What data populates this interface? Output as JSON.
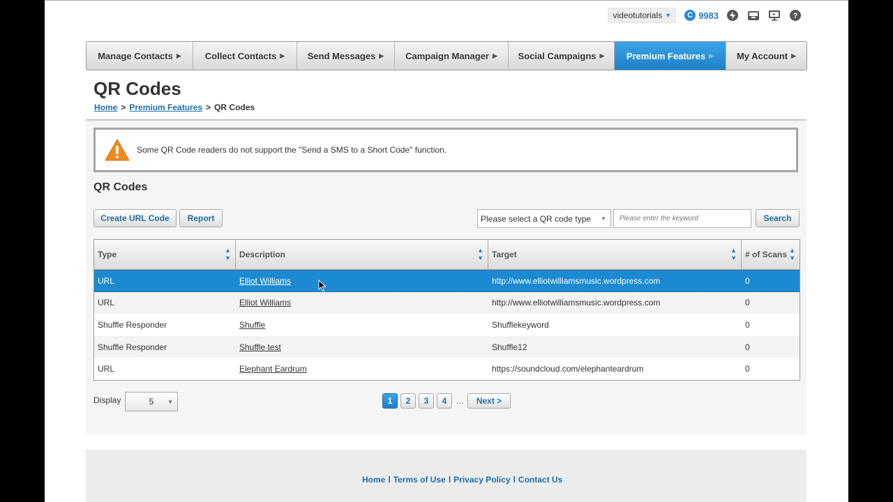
{
  "topbar": {
    "username": "videotutorials",
    "credits_icon": "C",
    "credits": "9983",
    "icons": [
      "lightning-icon",
      "inbox-icon",
      "monitor-icon",
      "help-icon"
    ]
  },
  "nav": [
    {
      "label": "Manage Contacts"
    },
    {
      "label": "Collect Contacts"
    },
    {
      "label": "Send Messages"
    },
    {
      "label": "Campaign Manager"
    },
    {
      "label": "Social Campaigns"
    },
    {
      "label": "Premium Features"
    },
    {
      "label": "My Account"
    }
  ],
  "page": {
    "title": "QR Codes",
    "breadcrumb": {
      "home": "Home",
      "section": "Premium Features",
      "current": "QR Codes",
      "sep": ">"
    }
  },
  "alert": {
    "message": "Some QR Code readers do not support the \"Send a SMS to a Short Code\" function."
  },
  "section": {
    "title": "QR Codes"
  },
  "toolbar": {
    "create_label": "Create URL Code",
    "report_label": "Report",
    "type_select": "Please select a QR code type",
    "search_placeholder": "Please enter the keyword",
    "search_label": "Search"
  },
  "table": {
    "columns": [
      "Type",
      "Description",
      "Target",
      "# of Scans"
    ],
    "rows": [
      {
        "type": "URL",
        "description": "Elliot Williams",
        "target": "http://www.elliotwilliamsmusic.wordpress.com",
        "scans": "0"
      },
      {
        "type": "URL",
        "description": "Elliot Williams",
        "target": "http://www.elliotwilliamsmusic.wordpress.com",
        "scans": "0"
      },
      {
        "type": "Shuffle Responder",
        "description": "Shuffle",
        "target": "Shufflekeyword",
        "scans": "0"
      },
      {
        "type": "Shuffle Responder",
        "description": "Shuffle test",
        "target": "Shuffle12",
        "scans": "0"
      },
      {
        "type": "URL",
        "description": "Elephant Eardrum",
        "target": "https://soundcloud.com/elephanteardrum",
        "scans": "0"
      }
    ]
  },
  "pagination": {
    "display_label": "Display",
    "display_value": "5",
    "pages": [
      "1",
      "2",
      "3",
      "4"
    ],
    "ellipsis": "…",
    "next_label": "Next >"
  },
  "footer": {
    "links": [
      "Home",
      "Terms of Use",
      "Privacy Policy",
      "Contact Us"
    ],
    "sep": "l"
  },
  "colors": {
    "accent": "#1e7fc8",
    "link": "#1f6fa8",
    "warning": "#f08a1c"
  }
}
